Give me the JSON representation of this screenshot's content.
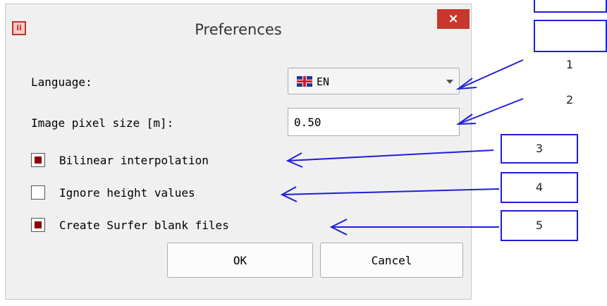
{
  "dialog": {
    "title": "Preferences",
    "close_label": "×",
    "app_icon_glyph": "ii"
  },
  "language": {
    "label": "Language:",
    "value": "EN",
    "flag_icon": "uk-flag-icon"
  },
  "pixel_size": {
    "label": "Image pixel size [m]:",
    "value": "0.50"
  },
  "checkboxes": [
    {
      "label": "Bilinear interpolation",
      "checked": true
    },
    {
      "label": "Ignore height values",
      "checked": false
    },
    {
      "label": "Create Surfer blank files",
      "checked": true
    }
  ],
  "buttons": {
    "ok": "OK",
    "cancel": "Cancel"
  },
  "annotations": [
    "1",
    "2",
    "3",
    "4",
    "5"
  ],
  "colors": {
    "annotation_blue": "#1f1fd6",
    "close_red": "#c8372d",
    "check_fill": "#8b0000"
  }
}
